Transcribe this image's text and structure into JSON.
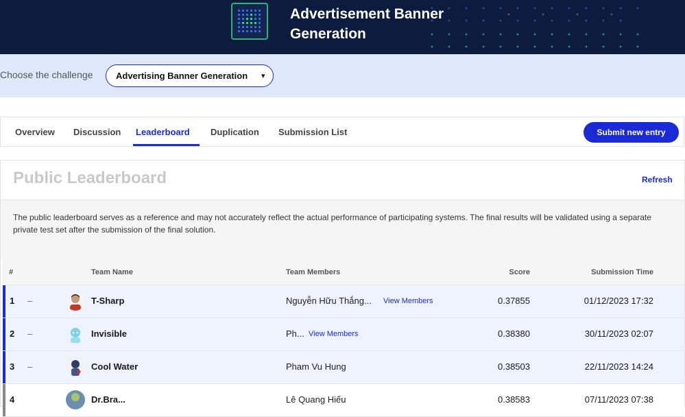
{
  "banner": {
    "title_line1": "Advertisement Banner",
    "title_line2": "Generation"
  },
  "challenge": {
    "label": "Choose the challenge",
    "selected": "Advertising Banner Generation",
    "caret": "▾"
  },
  "tabs": {
    "overview": "Overview",
    "discussion": "Discussion",
    "leaderboard": "Leaderboard",
    "duplication": "Duplication",
    "submission_list": "Submission List",
    "active": "Leaderboard",
    "submit": "Submit new entry"
  },
  "leaderboard": {
    "title": "Public Leaderboard",
    "refresh": "Refresh",
    "notice": "The public leaderboard serves as a reference and may not accurately reflect the actual performance of participating systems. The final results will be validated using a separate private test set after the submission of the final solution.",
    "columns": {
      "rank": "#",
      "team": "Team Name",
      "members": "Team Members",
      "score": "Score",
      "time": "Submission Time"
    },
    "rows": [
      {
        "rank": "1",
        "change": "–",
        "team": "T-Sharp",
        "members": "Nguyễn Hữu Thắng...",
        "view": "View Members",
        "score": "0.37855",
        "time": "01/12/2023 17:32"
      },
      {
        "rank": "2",
        "change": "–",
        "team": "Invisible",
        "members": "Ph...",
        "view": "View Members",
        "score": "0.38380",
        "time": "30/11/2023 02:07"
      },
      {
        "rank": "3",
        "change": "–",
        "team": "Cool Water",
        "members": "Pham Vu Hung",
        "view": "",
        "score": "0.38503",
        "time": "22/11/2023 14:24"
      },
      {
        "rank": "4",
        "change": "–",
        "team": "Dr.Bra...",
        "members": "Lê Quang Hiếu",
        "view": "",
        "score": "0.38583",
        "time": "07/11/2023 07:38"
      }
    ]
  },
  "colors": {
    "accent": "#1a2ad6",
    "banner_bg": "#0d1b3e",
    "challenge_bg": "#dfe8fb"
  }
}
